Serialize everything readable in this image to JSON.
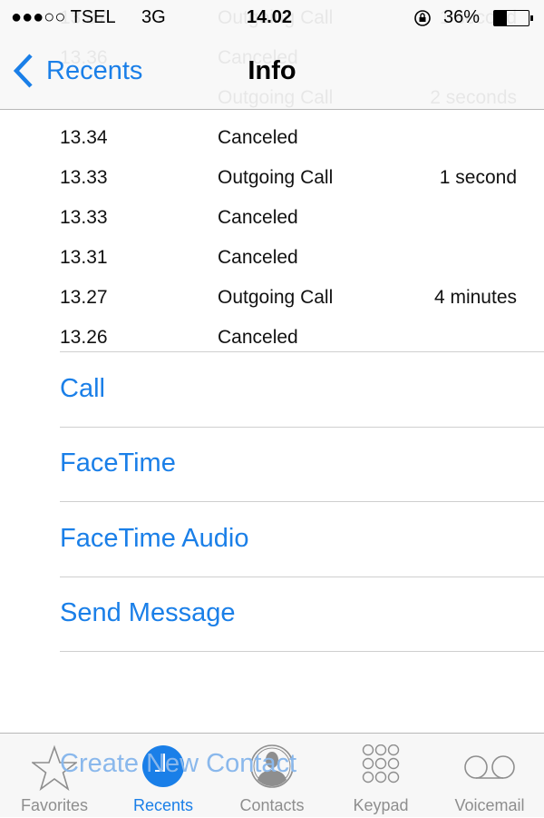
{
  "status_bar": {
    "carrier": "●●●○○ TSEL",
    "network": "3G",
    "time": "14.02",
    "battery": "36%",
    "battery_level": 0.36
  },
  "nav": {
    "back_label": "Recents",
    "title": "Info"
  },
  "calls": [
    {
      "time": "13.37",
      "type": "Outgoing Call",
      "duration": "1 second"
    },
    {
      "time": "13.36",
      "type": "Canceled",
      "duration": ""
    },
    {
      "time": "",
      "type": "Outgoing Call",
      "duration": "2 seconds"
    },
    {
      "time": "13.34",
      "type": "Canceled",
      "duration": ""
    },
    {
      "time": "13.33",
      "type": "Outgoing Call",
      "duration": "1 second"
    },
    {
      "time": "13.33",
      "type": "Canceled",
      "duration": ""
    },
    {
      "time": "13.31",
      "type": "Canceled",
      "duration": ""
    },
    {
      "time": "13.27",
      "type": "Outgoing Call",
      "duration": "4 minutes"
    },
    {
      "time": "13.26",
      "type": "Canceled",
      "duration": ""
    }
  ],
  "actions": [
    "Call",
    "FaceTime",
    "FaceTime Audio",
    "Send Message"
  ],
  "create_contact": "Create New Contact",
  "tabs": [
    {
      "label": "Favorites",
      "icon": "star-icon"
    },
    {
      "label": "Recents",
      "icon": "clock-icon",
      "active": true
    },
    {
      "label": "Contacts",
      "icon": "person-icon"
    },
    {
      "label": "Keypad",
      "icon": "keypad-icon"
    },
    {
      "label": "Voicemail",
      "icon": "voicemail-icon"
    }
  ],
  "colors": {
    "accent": "#1a7fe8",
    "inactive": "#8e8e8e"
  }
}
